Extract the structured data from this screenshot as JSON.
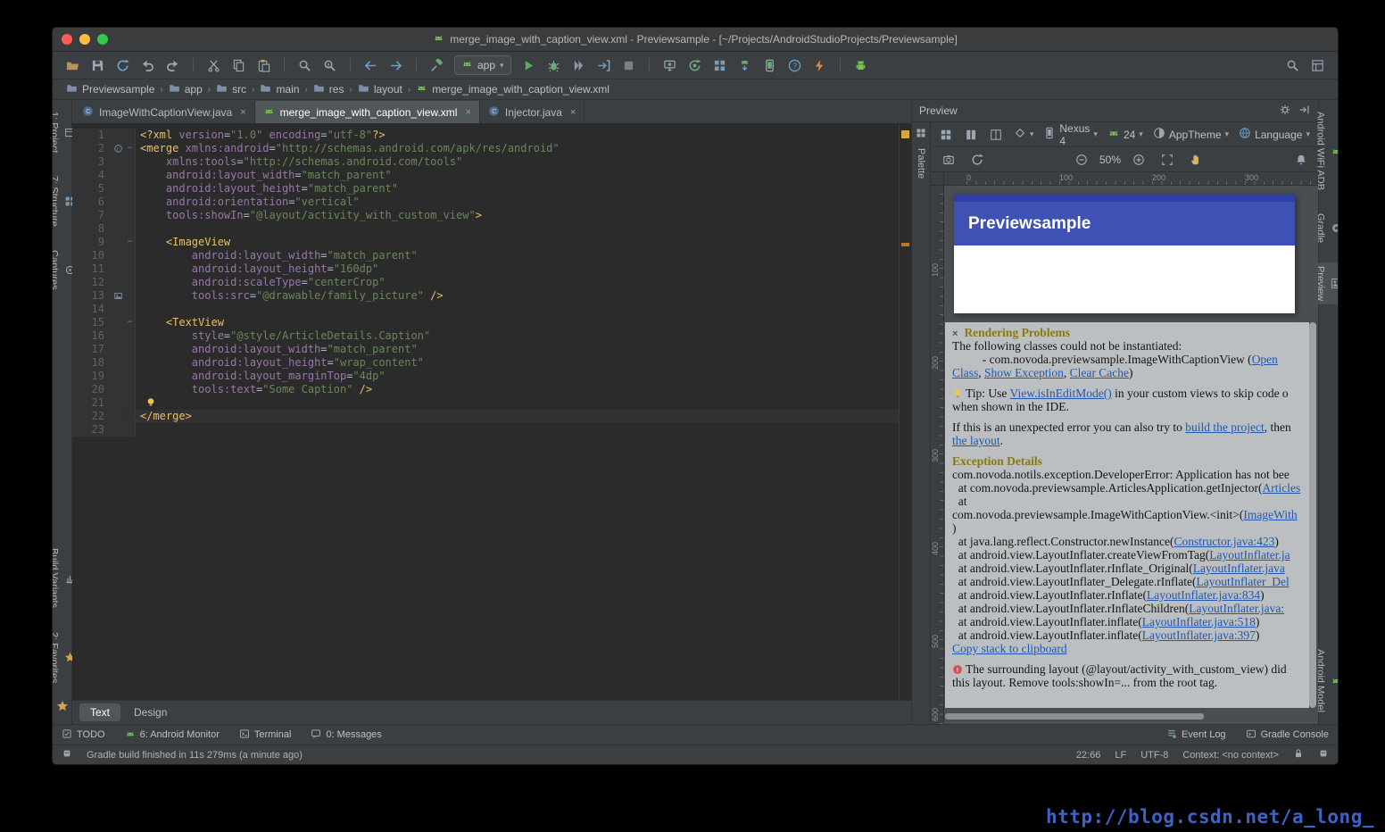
{
  "window_title": "merge_image_with_caption_view.xml - Previewsample - [~/Projects/AndroidStudioProjects/Previewsample]",
  "colors": {
    "app_bar_blue": "#3f51b5",
    "app_statusbar_blue": "#303f9f",
    "problems_panel_bg": "#bcbfc1",
    "link_blue": "#2157ad",
    "xml_tag": "#e8bf6a",
    "xml_attribute": "#9876aa",
    "xml_string": "#6a8759"
  },
  "glyphs": {
    "close": "×",
    "crumb_sep": "›",
    "dropdown": "▾",
    "fold": "−"
  },
  "toolbar": {
    "run_config_label": "app",
    "items": [
      {
        "name": "open",
        "icon": "folder"
      },
      {
        "name": "save-all",
        "icon": "save"
      },
      {
        "name": "synchronize",
        "icon": "sync"
      },
      {
        "name": "undo",
        "icon": "undo"
      },
      {
        "name": "redo",
        "icon": "redo"
      },
      {
        "type": "sep"
      },
      {
        "name": "cut",
        "icon": "cut"
      },
      {
        "name": "copy",
        "icon": "copy"
      },
      {
        "name": "paste",
        "icon": "paste"
      },
      {
        "type": "sep"
      },
      {
        "name": "find",
        "icon": "find"
      },
      {
        "name": "replace",
        "icon": "replace"
      },
      {
        "type": "sep"
      },
      {
        "name": "back",
        "icon": "back"
      },
      {
        "name": "forward",
        "icon": "forward"
      },
      {
        "type": "sep"
      },
      {
        "name": "make-project",
        "icon": "hammer"
      },
      {
        "type": "runconfig"
      },
      {
        "name": "run",
        "icon": "run"
      },
      {
        "name": "debug",
        "icon": "debug"
      },
      {
        "name": "run-with-coverage",
        "icon": "coverage"
      },
      {
        "name": "attach-debugger",
        "icon": "attach"
      },
      {
        "name": "stop",
        "icon": "stop"
      },
      {
        "type": "sep"
      },
      {
        "name": "android-monitor",
        "icon": "monitor"
      },
      {
        "name": "sync-project-with-gradle",
        "icon": "gradlesync"
      },
      {
        "name": "project-structure",
        "icon": "structure"
      },
      {
        "name": "sdk-manager",
        "icon": "sdk"
      },
      {
        "name": "avd-manager",
        "icon": "avd"
      },
      {
        "name": "help",
        "icon": "help"
      },
      {
        "name": "instant-run",
        "icon": "instant"
      },
      {
        "type": "sep"
      },
      {
        "name": "android-device-monitor",
        "icon": "android"
      },
      {
        "type": "spacer"
      },
      {
        "name": "search-everywhere",
        "icon": "find"
      },
      {
        "name": "manage-layouts",
        "icon": "layoutbox"
      }
    ]
  },
  "breadcrumbs": {
    "items": [
      {
        "label": "Previewsample",
        "icon": "folderb"
      },
      {
        "label": "app",
        "icon": "folderb"
      },
      {
        "label": "src",
        "icon": "folderb"
      },
      {
        "label": "main",
        "icon": "folderb"
      },
      {
        "label": "res",
        "icon": "folderb"
      },
      {
        "label": "layout",
        "icon": "folderb"
      },
      {
        "label": "merge_image_with_caption_view.xml",
        "icon": "droidhead"
      }
    ]
  },
  "left_strip": {
    "top": [
      {
        "label": "1: Project",
        "icon": "projecticon"
      },
      {
        "label": "7: Structure",
        "icon": "structure"
      },
      {
        "label": "Captures",
        "icon": "captures"
      }
    ],
    "bottom": [
      {
        "label": "Build Variants",
        "icon": "buildv"
      },
      {
        "label": "2: Favorites",
        "icon": "star"
      }
    ]
  },
  "right_strip": {
    "items": [
      {
        "label": "Android WiFi ADB",
        "icon": "droidhead"
      },
      {
        "label": "Gradle",
        "icon": "gradleicon"
      },
      {
        "label": "Preview",
        "icon": "previewicon",
        "active": true
      },
      {
        "label": "Android Model",
        "icon": "droidhead",
        "bottom": true
      }
    ]
  },
  "editor": {
    "tabs": [
      {
        "label": "ImageWithCaptionView.java",
        "icon": "classicon"
      },
      {
        "label": "merge_image_with_caption_view.xml",
        "icon": "droidhead",
        "active": true
      },
      {
        "label": "Injector.java",
        "icon": "classicon"
      }
    ],
    "bottom_tabs": [
      {
        "label": "Text",
        "active": true
      },
      {
        "label": "Design"
      }
    ],
    "lines": [
      {
        "t": [
          [
            "g",
            "<?xml "
          ],
          [
            "a",
            "version"
          ],
          [
            "p",
            "="
          ],
          [
            "s",
            "\"1.0\""
          ],
          [
            "p",
            " "
          ],
          [
            "a",
            "encoding"
          ],
          [
            "p",
            "="
          ],
          [
            "s",
            "\"utf-8\""
          ],
          [
            "g",
            "?>"
          ]
        ]
      },
      {
        "gut": "c",
        "fold": true,
        "t": [
          [
            "g",
            "<merge "
          ],
          [
            "a",
            "xmlns:android"
          ],
          [
            "p",
            "="
          ],
          [
            "s",
            "\"http://schemas.android.com/apk/res/android\""
          ]
        ]
      },
      {
        "t": [
          [
            "p",
            "    "
          ],
          [
            "a",
            "xmlns:tools"
          ],
          [
            "p",
            "="
          ],
          [
            "s",
            "\"http://schemas.android.com/tools\""
          ]
        ]
      },
      {
        "t": [
          [
            "p",
            "    "
          ],
          [
            "a",
            "android:layout_width"
          ],
          [
            "p",
            "="
          ],
          [
            "s",
            "\"match_parent\""
          ]
        ]
      },
      {
        "t": [
          [
            "p",
            "    "
          ],
          [
            "a",
            "android:layout_height"
          ],
          [
            "p",
            "="
          ],
          [
            "s",
            "\"match_parent\""
          ]
        ]
      },
      {
        "t": [
          [
            "p",
            "    "
          ],
          [
            "a",
            "android:orientation"
          ],
          [
            "p",
            "="
          ],
          [
            "s",
            "\"vertical\""
          ]
        ]
      },
      {
        "t": [
          [
            "p",
            "    "
          ],
          [
            "a",
            "tools:showIn"
          ],
          [
            "p",
            "="
          ],
          [
            "s",
            "\"@layout/activity_with_custom_view\""
          ],
          [
            "g",
            ">"
          ]
        ]
      },
      {
        "t": []
      },
      {
        "fold": true,
        "t": [
          [
            "p",
            "    "
          ],
          [
            "g",
            "<ImageView"
          ]
        ]
      },
      {
        "t": [
          [
            "p",
            "        "
          ],
          [
            "a",
            "android:layout_width"
          ],
          [
            "p",
            "="
          ],
          [
            "s",
            "\"match_parent\""
          ]
        ]
      },
      {
        "t": [
          [
            "p",
            "        "
          ],
          [
            "a",
            "android:layout_height"
          ],
          [
            "p",
            "="
          ],
          [
            "s",
            "\"160dp\""
          ]
        ]
      },
      {
        "t": [
          [
            "p",
            "        "
          ],
          [
            "a",
            "android:scaleType"
          ],
          [
            "p",
            "="
          ],
          [
            "s",
            "\"centerCrop\""
          ]
        ]
      },
      {
        "gut": "img",
        "t": [
          [
            "p",
            "        "
          ],
          [
            "a",
            "tools:src"
          ],
          [
            "p",
            "="
          ],
          [
            "s",
            "\"@drawable/family_picture\""
          ],
          [
            "p",
            " "
          ],
          [
            "g",
            "/>"
          ]
        ]
      },
      {
        "t": []
      },
      {
        "fold": true,
        "t": [
          [
            "p",
            "    "
          ],
          [
            "g",
            "<TextView"
          ]
        ]
      },
      {
        "t": [
          [
            "p",
            "        "
          ],
          [
            "a",
            "style"
          ],
          [
            "p",
            "="
          ],
          [
            "s",
            "\"@style/ArticleDetails.Caption\""
          ]
        ]
      },
      {
        "t": [
          [
            "p",
            "        "
          ],
          [
            "a",
            "android:layout_width"
          ],
          [
            "p",
            "="
          ],
          [
            "s",
            "\"match_parent\""
          ]
        ]
      },
      {
        "t": [
          [
            "p",
            "        "
          ],
          [
            "a",
            "android:layout_height"
          ],
          [
            "p",
            "="
          ],
          [
            "s",
            "\"wrap_content\""
          ]
        ]
      },
      {
        "t": [
          [
            "p",
            "        "
          ],
          [
            "a",
            "android:layout_marginTop"
          ],
          [
            "p",
            "="
          ],
          [
            "s",
            "\"4dp\""
          ]
        ]
      },
      {
        "t": [
          [
            "p",
            "        "
          ],
          [
            "a",
            "tools:text"
          ],
          [
            "p",
            "="
          ],
          [
            "s",
            "\"Some Caption\""
          ],
          [
            "p",
            " "
          ],
          [
            "g",
            "/>"
          ]
        ]
      },
      {
        "bulb": true,
        "t": []
      },
      {
        "hl": true,
        "t": [
          [
            "g",
            "</merge>"
          ]
        ]
      },
      {
        "t": []
      }
    ]
  },
  "preview": {
    "title": "Preview",
    "palette_label": "Palette",
    "toolbar1": {
      "config_icons": [
        "grid",
        "cols",
        "split"
      ],
      "orientation_icon": "diamond",
      "selectors": [
        {
          "icon": "phone",
          "label": "Nexus 4"
        },
        {
          "icon": "droidhead",
          "label": "24"
        },
        {
          "icon": "theme",
          "label": "AppTheme"
        },
        {
          "icon": "globe",
          "label": "Language"
        }
      ]
    },
    "toolbar2": {
      "left_icons": [
        "camera",
        "refresh"
      ],
      "zoom": "50%"
    },
    "ruler": {
      "h": [
        "0",
        "100",
        "200",
        "300"
      ],
      "v": [
        "100",
        "200",
        "300",
        "400",
        "500",
        "600"
      ]
    },
    "canvas": {
      "app_title": "Previewsample",
      "bar_color": "#3f51b5",
      "statusbar_color": "#303f9f"
    },
    "problems": {
      "lines": [
        {
          "seg": [
            [
              "x",
              "×"
            ],
            [
              "h",
              "Rendering Problems"
            ]
          ]
        },
        {
          "seg": [
            [
              "t",
              "The following classes could not be instantiated:"
            ]
          ]
        },
        {
          "seg": [
            [
              "t",
              "          - com.novoda.previewsample.ImageWithCaptionView ("
            ],
            [
              "l",
              "Open"
            ]
          ]
        },
        {
          "seg": [
            [
              "l",
              "Class"
            ],
            [
              "t",
              ", "
            ],
            [
              "l",
              "Show Exception"
            ],
            [
              "t",
              ", "
            ],
            [
              "l",
              "Clear Cache"
            ],
            [
              "t",
              ")"
            ]
          ]
        },
        {
          "seg": []
        },
        {
          "seg": [
            [
              "bulb",
              ""
            ],
            [
              "t",
              "Tip: Use "
            ],
            [
              "l",
              "View.isInEditMode()"
            ],
            [
              "t",
              " in your custom views to skip code o"
            ]
          ]
        },
        {
          "seg": [
            [
              "t",
              "when shown in the IDE."
            ]
          ]
        },
        {
          "seg": []
        },
        {
          "seg": [
            [
              "t",
              "If this is an unexpected error you can also try to "
            ],
            [
              "l",
              "build the project"
            ],
            [
              "t",
              ", then"
            ]
          ]
        },
        {
          "seg": [
            [
              "l",
              "the layout"
            ],
            [
              "t",
              "."
            ]
          ]
        },
        {
          "seg": []
        },
        {
          "seg": [
            [
              "h",
              "Exception Details"
            ]
          ]
        },
        {
          "seg": [
            [
              "t",
              "com.novoda.notils.exception.DeveloperError: Application has not bee"
            ]
          ]
        },
        {
          "seg": [
            [
              "t",
              "  at com.novoda.previewsample.ArticlesApplication.getInjector("
            ],
            [
              "l",
              "Articles"
            ]
          ]
        },
        {
          "seg": [
            [
              "t",
              "  at"
            ]
          ]
        },
        {
          "seg": [
            [
              "t",
              "com.novoda.previewsample.ImageWithCaptionView.<init>("
            ],
            [
              "l",
              "ImageWith"
            ]
          ]
        },
        {
          "seg": [
            [
              "t",
              ")"
            ]
          ]
        },
        {
          "seg": [
            [
              "t",
              "  at java.lang.reflect.Constructor.newInstance("
            ],
            [
              "l",
              "Constructor.java:423"
            ],
            [
              "t",
              ")"
            ]
          ]
        },
        {
          "seg": [
            [
              "t",
              "  at android.view.LayoutInflater.createViewFromTag("
            ],
            [
              "l",
              "LayoutInflater.ja"
            ]
          ]
        },
        {
          "seg": [
            [
              "t",
              "  at android.view.LayoutInflater.rInflate_Original("
            ],
            [
              "l",
              "LayoutInflater.java"
            ]
          ]
        },
        {
          "seg": [
            [
              "t",
              "  at android.view.LayoutInflater_Delegate.rInflate("
            ],
            [
              "l",
              "LayoutInflater_Del"
            ]
          ]
        },
        {
          "seg": [
            [
              "t",
              "  at android.view.LayoutInflater.rInflate("
            ],
            [
              "l",
              "LayoutInflater.java:834"
            ],
            [
              "t",
              ")"
            ]
          ]
        },
        {
          "seg": [
            [
              "t",
              "  at android.view.LayoutInflater.rInflateChildren("
            ],
            [
              "l",
              "LayoutInflater.java:"
            ]
          ]
        },
        {
          "seg": [
            [
              "t",
              "  at android.view.LayoutInflater.inflate("
            ],
            [
              "l",
              "LayoutInflater.java:518"
            ],
            [
              "t",
              ")"
            ]
          ]
        },
        {
          "seg": [
            [
              "t",
              "  at android.view.LayoutInflater.inflate("
            ],
            [
              "l",
              "LayoutInflater.java:397"
            ],
            [
              "t",
              ")"
            ]
          ]
        },
        {
          "seg": [
            [
              "l",
              "Copy stack to clipboard"
            ]
          ]
        },
        {
          "seg": []
        },
        {
          "seg": [
            [
              "warn",
              ""
            ],
            [
              "t",
              "The surrounding layout (@layout/activity_with_custom_view) did "
            ]
          ]
        },
        {
          "seg": [
            [
              "t",
              "this layout. Remove tools:showIn=... from the root tag."
            ]
          ]
        }
      ]
    }
  },
  "bottom_bar": {
    "left": [
      {
        "label": "TODO",
        "icon": "todo"
      },
      {
        "label": "6: Android Monitor",
        "icon": "droidhead"
      },
      {
        "label": "Terminal",
        "icon": "terminal"
      },
      {
        "label": "0: Messages",
        "icon": "balloon"
      }
    ],
    "right": [
      {
        "label": "Event Log",
        "icon": "eventlog"
      },
      {
        "label": "Gradle Console",
        "icon": "gradleconsole"
      }
    ]
  },
  "status_bar": {
    "message": "Gradle build finished in 11s 279ms (a minute ago)",
    "position": "22:66",
    "line_ending": "LF",
    "encoding": "UTF-8",
    "context": "Context: <no context>"
  },
  "watermark": "http://blog.csdn.net/a_long_"
}
